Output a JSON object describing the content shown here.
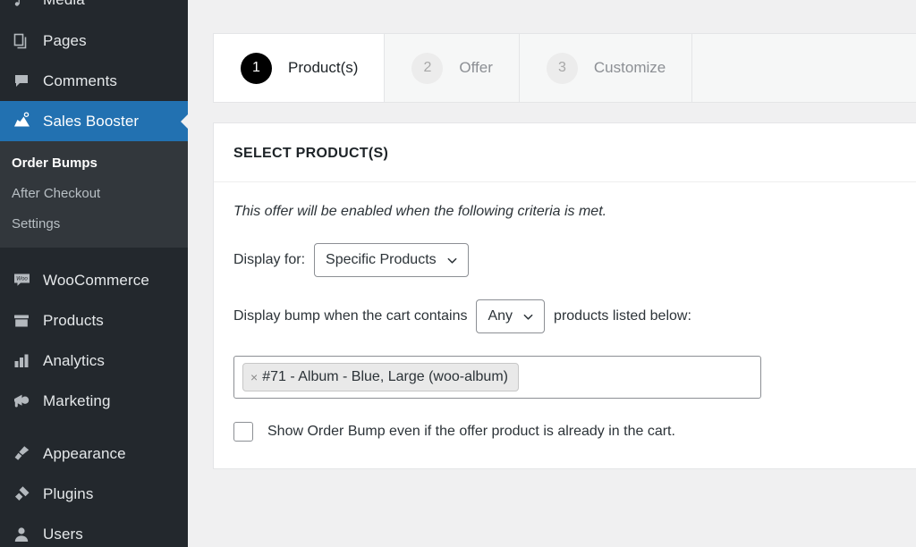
{
  "sidebar": {
    "top_items": [
      {
        "label": "Media",
        "icon": "media-icon"
      },
      {
        "label": "Pages",
        "icon": "pages-icon"
      },
      {
        "label": "Comments",
        "icon": "comments-icon"
      }
    ],
    "current_item": {
      "label": "Sales Booster",
      "icon": "sales-booster-icon"
    },
    "submenu": [
      {
        "label": "Order Bumps",
        "current": true
      },
      {
        "label": "After Checkout",
        "current": false
      },
      {
        "label": "Settings",
        "current": false
      }
    ],
    "store_items": [
      {
        "label": "WooCommerce",
        "icon": "woocommerce-icon"
      },
      {
        "label": "Products",
        "icon": "products-icon"
      },
      {
        "label": "Analytics",
        "icon": "analytics-icon"
      },
      {
        "label": "Marketing",
        "icon": "marketing-icon"
      }
    ],
    "bottom_items": [
      {
        "label": "Appearance",
        "icon": "appearance-icon"
      },
      {
        "label": "Plugins",
        "icon": "plugins-icon"
      },
      {
        "label": "Users",
        "icon": "users-icon"
      }
    ]
  },
  "tabs": [
    {
      "number": "1",
      "label": "Product(s)",
      "active": true
    },
    {
      "number": "2",
      "label": "Offer",
      "active": false
    },
    {
      "number": "3",
      "label": "Customize",
      "active": false
    }
  ],
  "panel": {
    "title": "SELECT PRODUCT(S)",
    "criteria_note": "This offer will be enabled when the following criteria is met.",
    "display_for_label": "Display for:",
    "display_for_value": "Specific Products",
    "cart_contains_prefix": "Display bump when the cart contains",
    "cart_contains_value": "Any",
    "cart_contains_suffix": "products listed below:",
    "product_token": "#71 - Album - Blue, Large (woo-album)",
    "token_remove_glyph": "×",
    "show_bump_checkbox_label": "Show Order Bump even if the offer product is already in the cart."
  },
  "colors": {
    "sidebar_bg": "#23282d",
    "submenu_bg": "#32373c",
    "accent_blue": "#2271b1",
    "content_bg": "#f0f0f1",
    "card_bg": "#ffffff",
    "active_step_bg": "#000000"
  }
}
